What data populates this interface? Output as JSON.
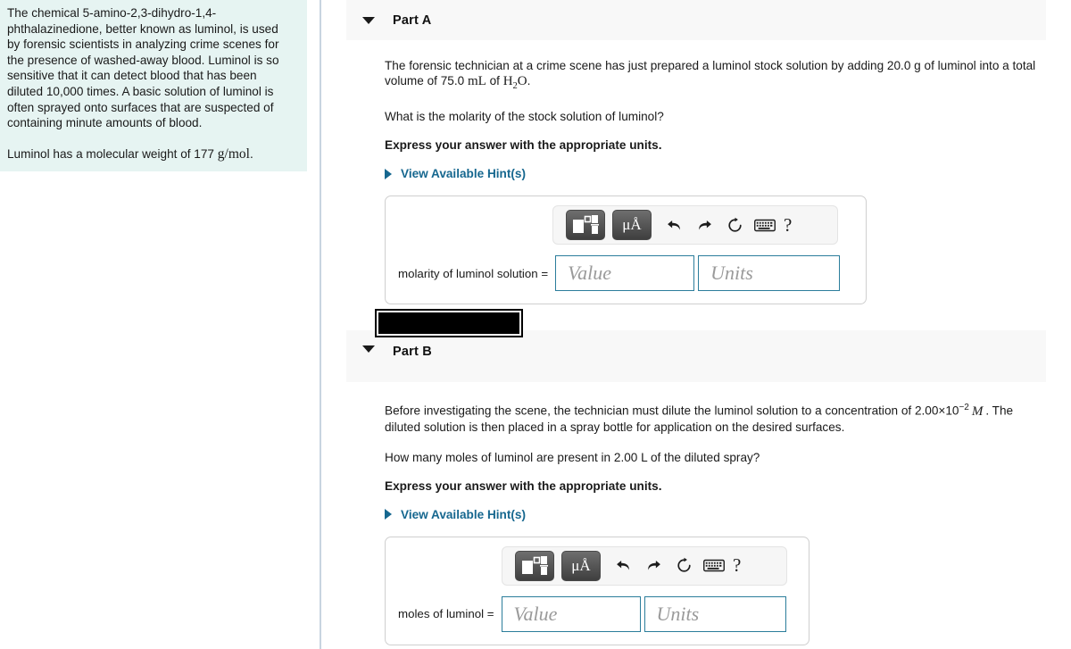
{
  "left_panel": {
    "paragraph_1": "The chemical 5-amino-2,3-dihydro-1,4-phthalazinedione, better known as luminol, is used by forensic scientists in analyzing crime scenes for the presence of washed-away blood. Luminol is so sensitive that it can detect blood that has been diluted 10,000 times. A basic solution of luminol is often sprayed onto surfaces that are suspected of containing minute amounts of blood.",
    "paragraph_2_prefix": "Luminol has a molecular weight of 177 ",
    "paragraph_2_units": "g/mol",
    "paragraph_2_suffix": ".",
    "background_color": "#e6f4f2"
  },
  "part_a": {
    "title": "Part A",
    "collapse_icon": "caret-down-icon",
    "statement_prefix": "The forensic technician at a crime scene has just prepared a luminol stock solution by adding  20.0 g of luminol into a total volume of 75.0 ",
    "statement_units": "mL",
    "statement_mid": " of ",
    "statement_formula_h": "H",
    "statement_formula_sub": "2",
    "statement_formula_o": "O",
    "statement_suffix": ".",
    "question": "What is the molarity of the stock solution of luminol?",
    "instruction": "Express your answer with the appropriate units.",
    "hint_label": "View Available Hint(s)",
    "hint_color": "#16678f",
    "answer_label": "molarity of luminol solution =",
    "value_placeholder": "Value",
    "units_placeholder": "Units",
    "value_current": "",
    "units_current": "",
    "toolbar": {
      "template_button": "math-template-button",
      "units_button": "μÅ",
      "undo_icon": "undo-icon",
      "redo_icon": "redo-icon",
      "reset_icon": "reset-icon",
      "keyboard_icon": "keyboard-icon",
      "help_label": "?"
    }
  },
  "part_b": {
    "title": "Part B",
    "collapse_icon": "caret-down-icon",
    "statement_prefix": "Before investigating the scene, the technician must dilute the luminol solution to a concentration of 2.00×10",
    "statement_exponent": "−2",
    "statement_unit_symbol": "M",
    "statement_suffix": ". The diluted solution is then placed in a spray bottle for application on the desired surfaces.",
    "question": "How many moles of luminol are present in 2.00 L of the diluted spray?",
    "instruction": "Express your answer with the appropriate units.",
    "hint_label": "View Available Hint(s)",
    "answer_label": "moles of luminol =",
    "value_placeholder": "Value",
    "units_placeholder": "Units",
    "value_current": "",
    "units_current": "",
    "toolbar": {
      "template_button": "math-template-button",
      "units_button": "μÅ",
      "undo_icon": "undo-icon",
      "redo_icon": "redo-icon",
      "reset_icon": "reset-icon",
      "keyboard_icon": "keyboard-icon",
      "help_label": "?"
    }
  },
  "redacted_block": {
    "name": "redacted-submit-area",
    "color": "#000000"
  }
}
